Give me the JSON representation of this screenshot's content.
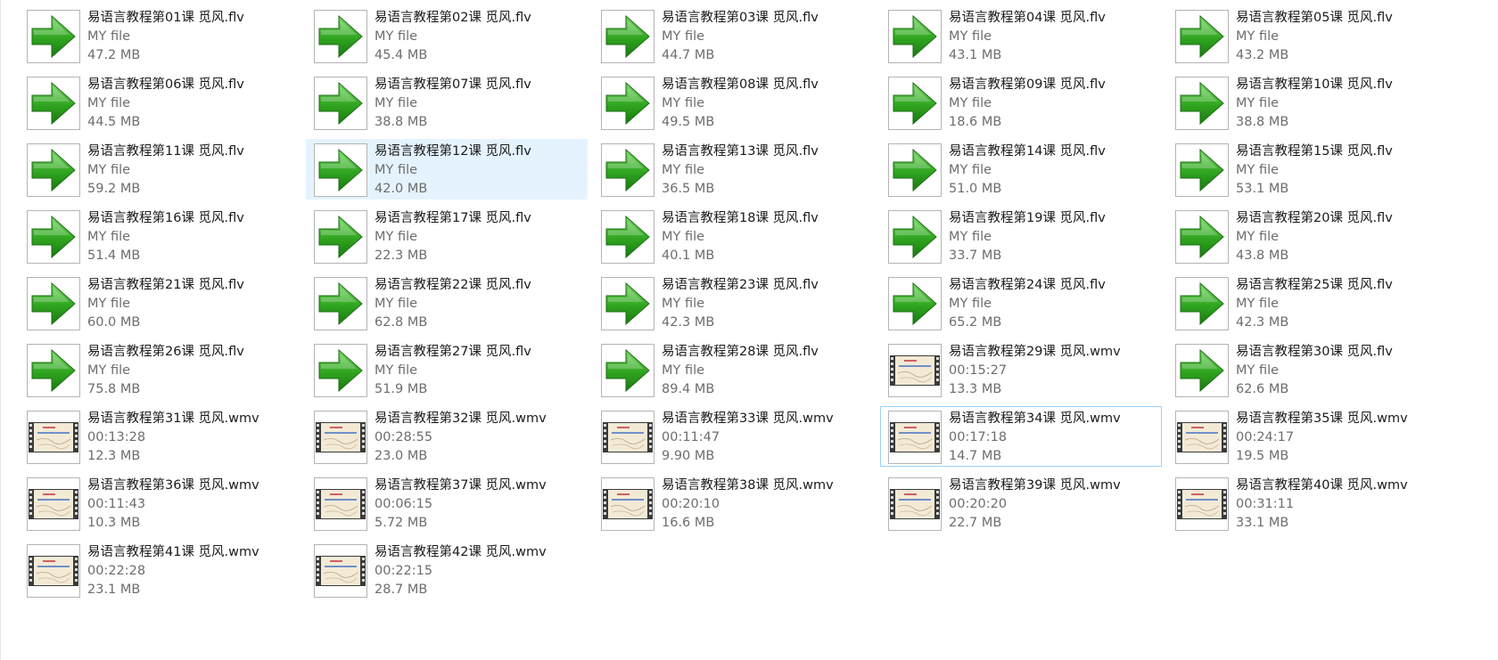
{
  "files": [
    {
      "name": "易语言教程第01课 觅风.flv",
      "line2": "MY file",
      "size": "47.2 MB",
      "icon": "green-arrow-icon"
    },
    {
      "name": "易语言教程第02课 觅风.flv",
      "line2": "MY file",
      "size": "45.4 MB",
      "icon": "green-arrow-icon"
    },
    {
      "name": "易语言教程第03课 觅风.flv",
      "line2": "MY file",
      "size": "44.7 MB",
      "icon": "green-arrow-icon"
    },
    {
      "name": "易语言教程第04课 觅风.flv",
      "line2": "MY file",
      "size": "43.1 MB",
      "icon": "green-arrow-icon"
    },
    {
      "name": "易语言教程第05课 觅风.flv",
      "line2": "MY file",
      "size": "43.2 MB",
      "icon": "green-arrow-icon"
    },
    {
      "name": "易语言教程第06课 觅风.flv",
      "line2": "MY file",
      "size": "44.5 MB",
      "icon": "green-arrow-icon"
    },
    {
      "name": "易语言教程第07课 觅风.flv",
      "line2": "MY file",
      "size": "38.8 MB",
      "icon": "green-arrow-icon"
    },
    {
      "name": "易语言教程第08课 觅风.flv",
      "line2": "MY file",
      "size": "49.5 MB",
      "icon": "green-arrow-icon"
    },
    {
      "name": "易语言教程第09课 觅风.flv",
      "line2": "MY file",
      "size": "18.6 MB",
      "icon": "green-arrow-icon"
    },
    {
      "name": "易语言教程第10课 觅风.flv",
      "line2": "MY file",
      "size": "38.8 MB",
      "icon": "green-arrow-icon"
    },
    {
      "name": "易语言教程第11课 觅风.flv",
      "line2": "MY file",
      "size": "59.2 MB",
      "icon": "green-arrow-icon"
    },
    {
      "name": "易语言教程第12课 觅风.flv",
      "line2": "MY file",
      "size": "42.0 MB",
      "icon": "green-arrow-icon",
      "selected": true
    },
    {
      "name": "易语言教程第13课 觅风.flv",
      "line2": "MY file",
      "size": "36.5 MB",
      "icon": "green-arrow-icon"
    },
    {
      "name": "易语言教程第14课 觅风.flv",
      "line2": "MY file",
      "size": "51.0 MB",
      "icon": "green-arrow-icon"
    },
    {
      "name": "易语言教程第15课 觅风.flv",
      "line2": "MY file",
      "size": "53.1 MB",
      "icon": "green-arrow-icon"
    },
    {
      "name": "易语言教程第16课 觅风.flv",
      "line2": "MY file",
      "size": "51.4 MB",
      "icon": "green-arrow-icon"
    },
    {
      "name": "易语言教程第17课 觅风.flv",
      "line2": "MY file",
      "size": "22.3 MB",
      "icon": "green-arrow-icon"
    },
    {
      "name": "易语言教程第18课 觅风.flv",
      "line2": "MY file",
      "size": "40.1 MB",
      "icon": "green-arrow-icon"
    },
    {
      "name": "易语言教程第19课 觅风.flv",
      "line2": "MY file",
      "size": "33.7 MB",
      "icon": "green-arrow-icon"
    },
    {
      "name": "易语言教程第20课 觅风.flv",
      "line2": "MY file",
      "size": "43.8 MB",
      "icon": "green-arrow-icon"
    },
    {
      "name": "易语言教程第21课 觅风.flv",
      "line2": "MY file",
      "size": "60.0 MB",
      "icon": "green-arrow-icon"
    },
    {
      "name": "易语言教程第22课 觅风.flv",
      "line2": "MY file",
      "size": "62.8 MB",
      "icon": "green-arrow-icon"
    },
    {
      "name": "易语言教程第23课 觅风.flv",
      "line2": "MY file",
      "size": "42.3 MB",
      "icon": "green-arrow-icon"
    },
    {
      "name": "易语言教程第24课 觅风.flv",
      "line2": "MY file",
      "size": "65.2 MB",
      "icon": "green-arrow-icon"
    },
    {
      "name": "易语言教程第25课 觅风.flv",
      "line2": "MY file",
      "size": "42.3 MB",
      "icon": "green-arrow-icon"
    },
    {
      "name": "易语言教程第26课 觅风.flv",
      "line2": "MY file",
      "size": "75.8 MB",
      "icon": "green-arrow-icon"
    },
    {
      "name": "易语言教程第27课 觅风.flv",
      "line2": "MY file",
      "size": "51.9 MB",
      "icon": "green-arrow-icon"
    },
    {
      "name": "易语言教程第28课 觅风.flv",
      "line2": "MY file",
      "size": "89.4 MB",
      "icon": "green-arrow-icon"
    },
    {
      "name": "易语言教程第29课 觅风.wmv",
      "line2": "00:15:27",
      "size": "13.3 MB",
      "icon": "video-thumbnail-icon"
    },
    {
      "name": "易语言教程第30课 觅风.flv",
      "line2": "MY file",
      "size": "62.6 MB",
      "icon": "green-arrow-icon"
    },
    {
      "name": "易语言教程第31课 觅风.wmv",
      "line2": "00:13:28",
      "size": "12.3 MB",
      "icon": "video-thumbnail-icon"
    },
    {
      "name": "易语言教程第32课 觅风.wmv",
      "line2": "00:28:55",
      "size": "23.0 MB",
      "icon": "video-thumbnail-icon"
    },
    {
      "name": "易语言教程第33课 觅风.wmv",
      "line2": "00:11:47",
      "size": "9.90 MB",
      "icon": "video-thumbnail-icon"
    },
    {
      "name": "易语言教程第34课 觅风.wmv",
      "line2": "00:17:18",
      "size": "14.7 MB",
      "icon": "video-thumbnail-icon",
      "focused": true
    },
    {
      "name": "易语言教程第35课 觅风.wmv",
      "line2": "00:24:17",
      "size": "19.5 MB",
      "icon": "video-thumbnail-icon"
    },
    {
      "name": "易语言教程第36课 觅风.wmv",
      "line2": "00:11:43",
      "size": "10.3 MB",
      "icon": "video-thumbnail-icon"
    },
    {
      "name": "易语言教程第37课 觅风.wmv",
      "line2": "00:06:15",
      "size": "5.72 MB",
      "icon": "video-thumbnail-icon"
    },
    {
      "name": "易语言教程第38课 觅风.wmv",
      "line2": "00:20:10",
      "size": "16.6 MB",
      "icon": "video-thumbnail-icon"
    },
    {
      "name": "易语言教程第39课 觅风.wmv",
      "line2": "00:20:20",
      "size": "22.7 MB",
      "icon": "video-thumbnail-icon"
    },
    {
      "name": "易语言教程第40课 觅风.wmv",
      "line2": "00:31:11",
      "size": "33.1 MB",
      "icon": "video-thumbnail-icon"
    },
    {
      "name": "易语言教程第41课 觅风.wmv",
      "line2": "00:22:28",
      "size": "23.1 MB",
      "icon": "video-thumbnail-icon"
    },
    {
      "name": "易语言教程第42课 觅风.wmv",
      "line2": "00:22:15",
      "size": "28.7 MB",
      "icon": "video-thumbnail-icon"
    }
  ],
  "colors": {
    "selection_bg": "#e5f3ff",
    "focus_border": "#99d1ff",
    "name_text": "#1a1a1a",
    "detail_text": "#6d6d6d",
    "arrow_green": "#2e9f1e"
  }
}
